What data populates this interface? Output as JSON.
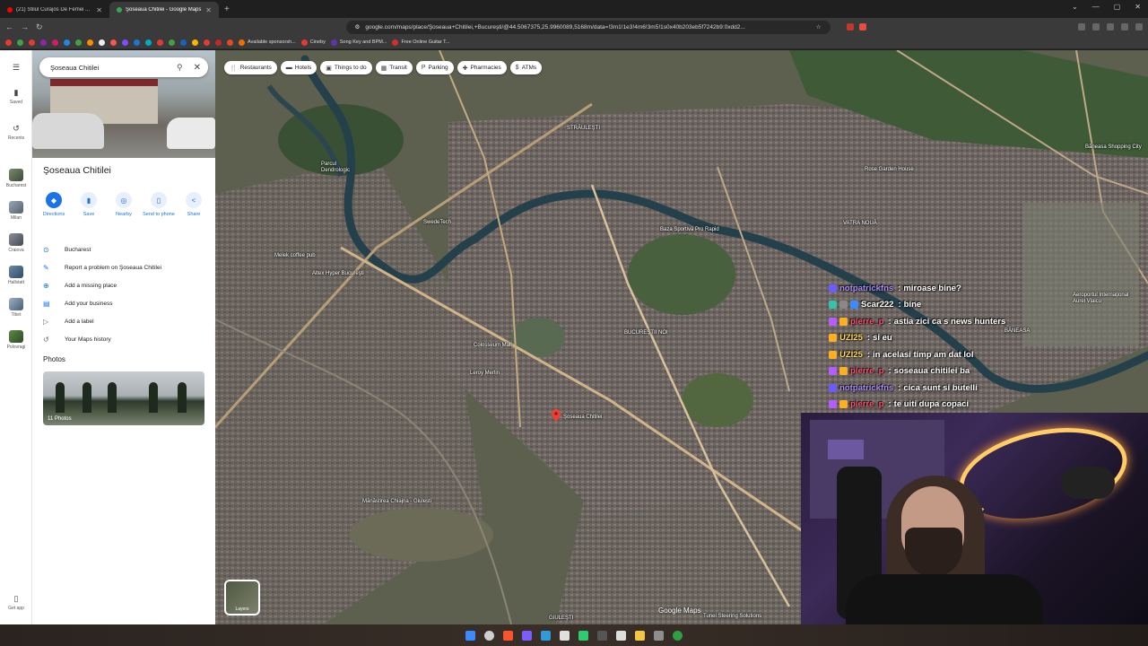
{
  "browser": {
    "tabs": [
      {
        "label": "(21) Stilul Curajos De Femei Al Lumii",
        "active": false,
        "color": "#ff0000"
      },
      {
        "label": "Şoseaua Chitilei - Google Maps",
        "active": true,
        "color": "#34a853"
      }
    ],
    "new_tab": "+",
    "url": "google.com/maps/place/Şoseaua+Chitilei,+Bucureşti/@44.5067375,25.9960089,5168m/data=!3m1!1e3!4m6!3m5!1s0x40b203eb5f7242b9:0xdd2...",
    "bookmarks": [
      {
        "label": "Available sponsorsh..."
      },
      {
        "label": "Cineby"
      },
      {
        "label": "Song Key and BPM..."
      },
      {
        "label": "Free Online Guitar T..."
      }
    ]
  },
  "rail": {
    "items": [
      {
        "label": "Saved",
        "icon": "bookmark-icon"
      },
      {
        "label": "Recents",
        "icon": "history-icon"
      },
      {
        "label": "Bucharest"
      },
      {
        "label": "Milan"
      },
      {
        "label": "Craiova"
      },
      {
        "label": "Hallstatt"
      },
      {
        "label": "Tibet"
      },
      {
        "label": "Polovragi"
      }
    ],
    "get_app": "Get app"
  },
  "panel": {
    "search_value": "Şoseaua Chitilei",
    "title": "Şoseaua Chitilei",
    "actions": [
      {
        "label": "Directions",
        "icon": "directions-icon",
        "glyph": "◆"
      },
      {
        "label": "Save",
        "icon": "bookmark-icon",
        "glyph": "▮"
      },
      {
        "label": "Nearby",
        "icon": "nearby-icon",
        "glyph": "◎"
      },
      {
        "label": "Send to phone",
        "icon": "phone-icon",
        "glyph": "▯"
      },
      {
        "label": "Share",
        "icon": "share-icon",
        "glyph": "<"
      }
    ],
    "info": [
      {
        "label": "Bucharest",
        "icon": "location-pin-icon",
        "glyph": "⊙"
      },
      {
        "label": "Report a problem on Şoseaua Chitilei",
        "icon": "edit-icon",
        "glyph": "✎"
      },
      {
        "label": "Add a missing place",
        "icon": "add-place-icon",
        "glyph": "⊕"
      },
      {
        "label": "Add your business",
        "icon": "business-icon",
        "glyph": "▤"
      },
      {
        "label": "Add a label",
        "icon": "label-icon",
        "glyph": "▷"
      },
      {
        "label": "Your Maps history",
        "icon": "history-icon",
        "glyph": "↺"
      }
    ],
    "photos_heading": "Photos",
    "photos_count": "11 Photos"
  },
  "map": {
    "chips": [
      {
        "label": "Restaurants",
        "glyph": "🍴"
      },
      {
        "label": "Hotels",
        "glyph": "▬"
      },
      {
        "label": "Things to do",
        "glyph": "▣"
      },
      {
        "label": "Transit",
        "glyph": "▦"
      },
      {
        "label": "Parking",
        "glyph": "P"
      },
      {
        "label": "Pharmacies",
        "glyph": "✚"
      },
      {
        "label": "ATMs",
        "glyph": "$"
      }
    ],
    "labels": [
      {
        "text": "STRĂULEŞTI"
      },
      {
        "text": "VATRA NOUĂ"
      },
      {
        "text": "BUCUREŞTII NOI"
      },
      {
        "text": "Colosseum Mall"
      },
      {
        "text": "Leroy Merlin"
      },
      {
        "text": "Şoseaua Chitilei"
      },
      {
        "text": "Mănăstirea Chiajna - Giulesti"
      },
      {
        "text": "Baza Sportivă Pro Rapid"
      },
      {
        "text": "Rose Garden House"
      },
      {
        "text": "Băneasa Shopping City"
      },
      {
        "text": "Aeroportul Internaţional Aurel Vlaicu"
      },
      {
        "text": "BĂNEASA"
      },
      {
        "text": "Melek coffee pub"
      },
      {
        "text": "Altex Hyper Bucureşti"
      },
      {
        "text": "Parcul Dendrologic"
      },
      {
        "text": "SwedeTech"
      },
      {
        "text": "GIULEŞTI"
      },
      {
        "text": "Tunel Steering Solutions"
      }
    ],
    "layers": "Layers",
    "logo": "Google Maps"
  },
  "chat": {
    "messages": [
      {
        "user": "notpatrickfns",
        "text": "miroase bine?",
        "color": "#a78bfa",
        "badge": "#6b5cff"
      },
      {
        "user": "Scar222",
        "text": "bine",
        "color": "#ffffff",
        "badge": "#34c3ae"
      },
      {
        "user": "pierre_p",
        "text": "astia zici ca s news hunters",
        "color": "#ff4d6d",
        "badge": "#b75cff"
      },
      {
        "user": "UZI25",
        "text": "si eu",
        "color": "#ffd84d",
        "badge": "#ffb020"
      },
      {
        "user": "UZI25",
        "text": "in acelasi timp am dat lol",
        "color": "#ffd84d",
        "badge": "#ffb020"
      },
      {
        "user": "pierre_p",
        "text": "soseaua chitilei ba",
        "color": "#ff4d6d",
        "badge": "#b75cff"
      },
      {
        "user": "notpatrickfns",
        "text": "cica sunt si butelli",
        "color": "#a78bfa",
        "badge": "#6b5cff"
      },
      {
        "user": "pierre_p",
        "text": "te uiti dupa copaci",
        "color": "#ff4d6d",
        "badge": "#b75cff"
      }
    ]
  },
  "colors": {
    "accent": "#1a73e8",
    "pin": "#ea4335"
  }
}
